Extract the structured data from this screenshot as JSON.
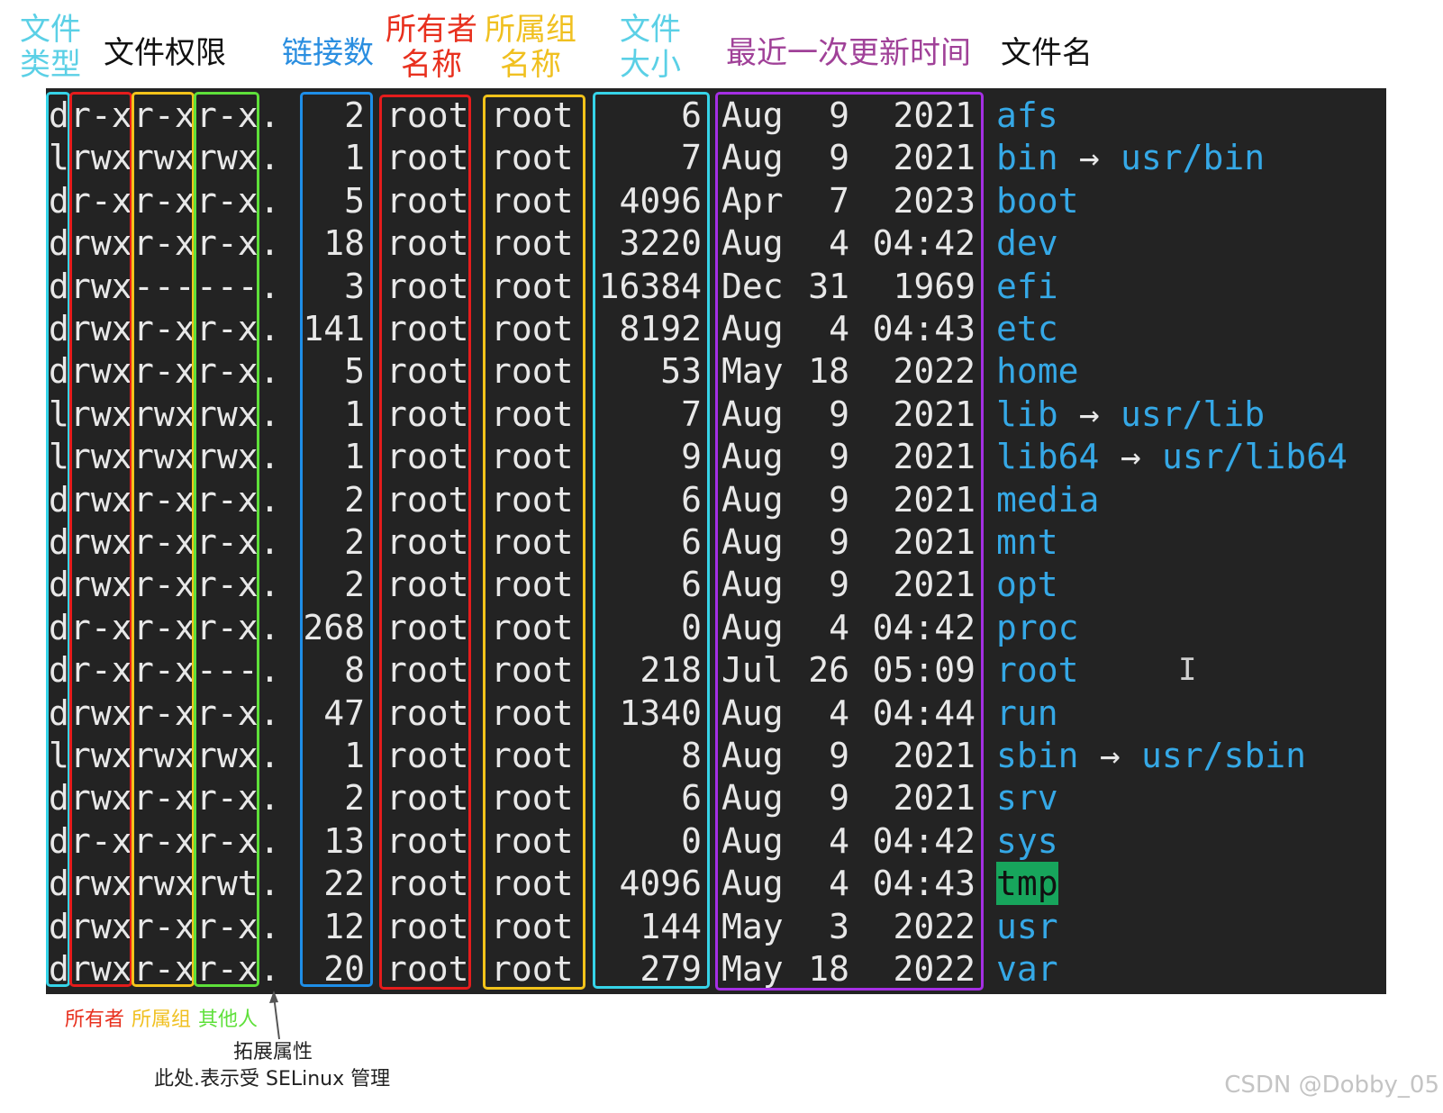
{
  "headers": {
    "file_type": [
      "文件",
      "类型"
    ],
    "permissions": [
      "文件权限"
    ],
    "links": [
      "链接数"
    ],
    "owner": [
      "所有者",
      "名称"
    ],
    "group": [
      "所属组",
      "名称"
    ],
    "size": [
      "文件",
      "大小"
    ],
    "mtime": [
      "最近一次更新时间"
    ],
    "filename": [
      "文件名"
    ]
  },
  "colors": {
    "file_type": "#5bd0e6",
    "permissions_text": "#111111",
    "links": "#2a8ee0",
    "owner": "#e8301e",
    "group": "#f0c020",
    "size": "#5bd0e6",
    "mtime": "#a04198",
    "filename_text": "#111111",
    "box_type": "#36d3e8",
    "box_owner_perm": "#e51c1c",
    "box_group_perm": "#f3c31a",
    "box_other_perm": "#5ee03a",
    "box_links": "#1e8ee8",
    "box_owner": "#e51c1c",
    "box_group": "#f3c31a",
    "box_size": "#36d3e8",
    "box_date": "#a52fe4",
    "terminal_bg": "#232323",
    "name_blue": "#35a8e6",
    "highlight_green": "#17a55c"
  },
  "rows": [
    {
      "type": "d",
      "u": "r-x",
      "g": "r-x",
      "o": "r-x",
      "attr": ".",
      "links": "2",
      "owner": "root",
      "group": "root",
      "size": "6",
      "month": "Aug",
      "day": "9",
      "time": "2021",
      "name": "afs",
      "arrow": "",
      "target": "",
      "highlight": false
    },
    {
      "type": "l",
      "u": "rwx",
      "g": "rwx",
      "o": "rwx",
      "attr": ".",
      "links": "1",
      "owner": "root",
      "group": "root",
      "size": "7",
      "month": "Aug",
      "day": "9",
      "time": "2021",
      "name": "bin",
      "arrow": "→",
      "target": "usr/bin",
      "highlight": false
    },
    {
      "type": "d",
      "u": "r-x",
      "g": "r-x",
      "o": "r-x",
      "attr": ".",
      "links": "5",
      "owner": "root",
      "group": "root",
      "size": "4096",
      "month": "Apr",
      "day": "7",
      "time": "2023",
      "name": "boot",
      "arrow": "",
      "target": "",
      "highlight": false
    },
    {
      "type": "d",
      "u": "rwx",
      "g": "r-x",
      "o": "r-x",
      "attr": ".",
      "links": "18",
      "owner": "root",
      "group": "root",
      "size": "3220",
      "month": "Aug",
      "day": "4",
      "time": "04:42",
      "name": "dev",
      "arrow": "",
      "target": "",
      "highlight": false
    },
    {
      "type": "d",
      "u": "rwx",
      "g": "---",
      "o": "---",
      "attr": ".",
      "links": "3",
      "owner": "root",
      "group": "root",
      "size": "16384",
      "month": "Dec",
      "day": "31",
      "time": "1969",
      "name": "efi",
      "arrow": "",
      "target": "",
      "highlight": false
    },
    {
      "type": "d",
      "u": "rwx",
      "g": "r-x",
      "o": "r-x",
      "attr": ".",
      "links": "141",
      "owner": "root",
      "group": "root",
      "size": "8192",
      "month": "Aug",
      "day": "4",
      "time": "04:43",
      "name": "etc",
      "arrow": "",
      "target": "",
      "highlight": false
    },
    {
      "type": "d",
      "u": "rwx",
      "g": "r-x",
      "o": "r-x",
      "attr": ".",
      "links": "5",
      "owner": "root",
      "group": "root",
      "size": "53",
      "month": "May",
      "day": "18",
      "time": "2022",
      "name": "home",
      "arrow": "",
      "target": "",
      "highlight": false
    },
    {
      "type": "l",
      "u": "rwx",
      "g": "rwx",
      "o": "rwx",
      "attr": ".",
      "links": "1",
      "owner": "root",
      "group": "root",
      "size": "7",
      "month": "Aug",
      "day": "9",
      "time": "2021",
      "name": "lib",
      "arrow": "→",
      "target": "usr/lib",
      "highlight": false
    },
    {
      "type": "l",
      "u": "rwx",
      "g": "rwx",
      "o": "rwx",
      "attr": ".",
      "links": "1",
      "owner": "root",
      "group": "root",
      "size": "9",
      "month": "Aug",
      "day": "9",
      "time": "2021",
      "name": "lib64",
      "arrow": "→",
      "target": "usr/lib64",
      "highlight": false
    },
    {
      "type": "d",
      "u": "rwx",
      "g": "r-x",
      "o": "r-x",
      "attr": ".",
      "links": "2",
      "owner": "root",
      "group": "root",
      "size": "6",
      "month": "Aug",
      "day": "9",
      "time": "2021",
      "name": "media",
      "arrow": "",
      "target": "",
      "highlight": false
    },
    {
      "type": "d",
      "u": "rwx",
      "g": "r-x",
      "o": "r-x",
      "attr": ".",
      "links": "2",
      "owner": "root",
      "group": "root",
      "size": "6",
      "month": "Aug",
      "day": "9",
      "time": "2021",
      "name": "mnt",
      "arrow": "",
      "target": "",
      "highlight": false
    },
    {
      "type": "d",
      "u": "rwx",
      "g": "r-x",
      "o": "r-x",
      "attr": ".",
      "links": "2",
      "owner": "root",
      "group": "root",
      "size": "6",
      "month": "Aug",
      "day": "9",
      "time": "2021",
      "name": "opt",
      "arrow": "",
      "target": "",
      "highlight": false
    },
    {
      "type": "d",
      "u": "r-x",
      "g": "r-x",
      "o": "r-x",
      "attr": ".",
      "links": "268",
      "owner": "root",
      "group": "root",
      "size": "0",
      "month": "Aug",
      "day": "4",
      "time": "04:42",
      "name": "proc",
      "arrow": "",
      "target": "",
      "highlight": false
    },
    {
      "type": "d",
      "u": "r-x",
      "g": "r-x",
      "o": "---",
      "attr": ".",
      "links": "8",
      "owner": "root",
      "group": "root",
      "size": "218",
      "month": "Jul",
      "day": "26",
      "time": "05:09",
      "name": "root",
      "arrow": "",
      "target": "",
      "highlight": false
    },
    {
      "type": "d",
      "u": "rwx",
      "g": "r-x",
      "o": "r-x",
      "attr": ".",
      "links": "47",
      "owner": "root",
      "group": "root",
      "size": "1340",
      "month": "Aug",
      "day": "4",
      "time": "04:44",
      "name": "run",
      "arrow": "",
      "target": "",
      "highlight": false
    },
    {
      "type": "l",
      "u": "rwx",
      "g": "rwx",
      "o": "rwx",
      "attr": ".",
      "links": "1",
      "owner": "root",
      "group": "root",
      "size": "8",
      "month": "Aug",
      "day": "9",
      "time": "2021",
      "name": "sbin",
      "arrow": "→",
      "target": "usr/sbin",
      "highlight": false
    },
    {
      "type": "d",
      "u": "rwx",
      "g": "r-x",
      "o": "r-x",
      "attr": ".",
      "links": "2",
      "owner": "root",
      "group": "root",
      "size": "6",
      "month": "Aug",
      "day": "9",
      "time": "2021",
      "name": "srv",
      "arrow": "",
      "target": "",
      "highlight": false
    },
    {
      "type": "d",
      "u": "r-x",
      "g": "r-x",
      "o": "r-x",
      "attr": ".",
      "links": "13",
      "owner": "root",
      "group": "root",
      "size": "0",
      "month": "Aug",
      "day": "4",
      "time": "04:42",
      "name": "sys",
      "arrow": "",
      "target": "",
      "highlight": false
    },
    {
      "type": "d",
      "u": "rwx",
      "g": "rwx",
      "o": "rwt",
      "attr": ".",
      "links": "22",
      "owner": "root",
      "group": "root",
      "size": "4096",
      "month": "Aug",
      "day": "4",
      "time": "04:43",
      "name": "tmp",
      "arrow": "",
      "target": "",
      "highlight": true
    },
    {
      "type": "d",
      "u": "rwx",
      "g": "r-x",
      "o": "r-x",
      "attr": ".",
      "links": "12",
      "owner": "root",
      "group": "root",
      "size": "144",
      "month": "May",
      "day": "3",
      "time": "2022",
      "name": "usr",
      "arrow": "",
      "target": "",
      "highlight": false
    },
    {
      "type": "d",
      "u": "rwx",
      "g": "r-x",
      "o": "r-x",
      "attr": ".",
      "links": "20",
      "owner": "root",
      "group": "root",
      "size": "279",
      "month": "May",
      "day": "18",
      "time": "2022",
      "name": "var",
      "arrow": "",
      "target": "",
      "highlight": false
    }
  ],
  "bottom_labels": {
    "owner": "所有者",
    "group": "所属组",
    "others": "其他人",
    "ext_attr_title": "拓展属性",
    "ext_attr_desc": "此处.表示受 SELinux 管理"
  },
  "cursor_glyph": "I",
  "watermark": "CSDN @Dobby_05"
}
